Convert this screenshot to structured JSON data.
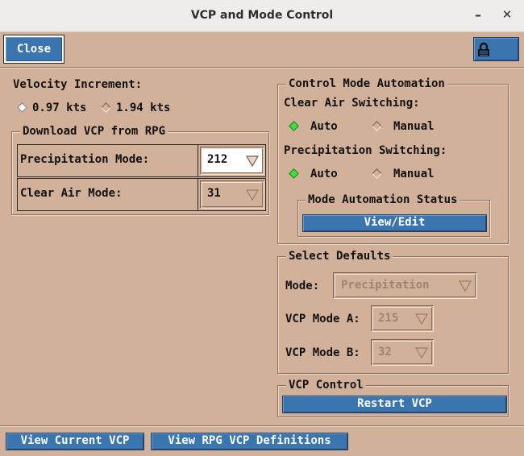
{
  "window": {
    "title": "VCP and Mode Control"
  },
  "toolbar": {
    "close_label": "Close"
  },
  "velocity": {
    "label": "Velocity Increment:",
    "options": [
      "0.97 kts",
      "1.94 kts"
    ],
    "selected": "0.97 kts"
  },
  "download": {
    "legend": "Download VCP from RPG",
    "precip_label": "Precipitation Mode:",
    "precip_value": "212",
    "clear_label": "Clear Air Mode:",
    "clear_value": "31"
  },
  "automation": {
    "legend": "Control Mode Automation",
    "clear_air_label": "Clear Air Switching:",
    "clear_air_options": [
      "Auto",
      "Manual"
    ],
    "clear_air_selected": "Auto",
    "precip_label": "Precipitation Switching:",
    "precip_options": [
      "Auto",
      "Manual"
    ],
    "precip_selected": "Auto",
    "status_legend": "Mode Automation Status",
    "view_edit_label": "View/Edit"
  },
  "defaults": {
    "legend": "Select Defaults",
    "mode_label": "Mode:",
    "mode_value": "Precipitation",
    "vcp_a_label": "VCP Mode A:",
    "vcp_a_value": "215",
    "vcp_b_label": "VCP Mode B:",
    "vcp_b_value": "32"
  },
  "vcp_control": {
    "legend": "VCP Control",
    "restart_label": "Restart VCP"
  },
  "footer": {
    "view_current_label": "View Current VCP",
    "view_defs_label": "View RPG VCP Definitions"
  },
  "colors": {
    "background": "#d2b19a",
    "button_blue": "#3a75b0",
    "radio_on": "#3de03d"
  },
  "icons": {
    "lock": "lock-icon",
    "dropdown": "chevron-down-icon"
  }
}
